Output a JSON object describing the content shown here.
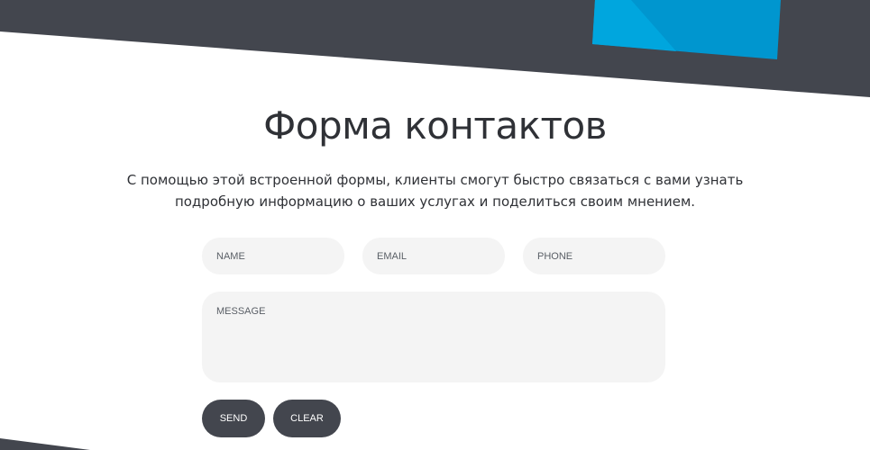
{
  "page": {
    "title": "Форма контактов",
    "description": "С помощью этой встроенной формы, клиенты смогут быстро связаться с вами узнать подробную информацию о ваших услугах и поделиться своим мнением."
  },
  "form": {
    "name_placeholder": "NAME",
    "email_placeholder": "EMAIL",
    "phone_placeholder": "PHONE",
    "message_placeholder": "MESSAGE",
    "send_label": "SEND",
    "clear_label": "CLEAR"
  },
  "colors": {
    "dark_band": "#43464e",
    "accent_blue": "#0096cf",
    "accent_blue_light": "#00a4dc",
    "field_background": "#f4f4f4",
    "text": "#2f3136"
  }
}
